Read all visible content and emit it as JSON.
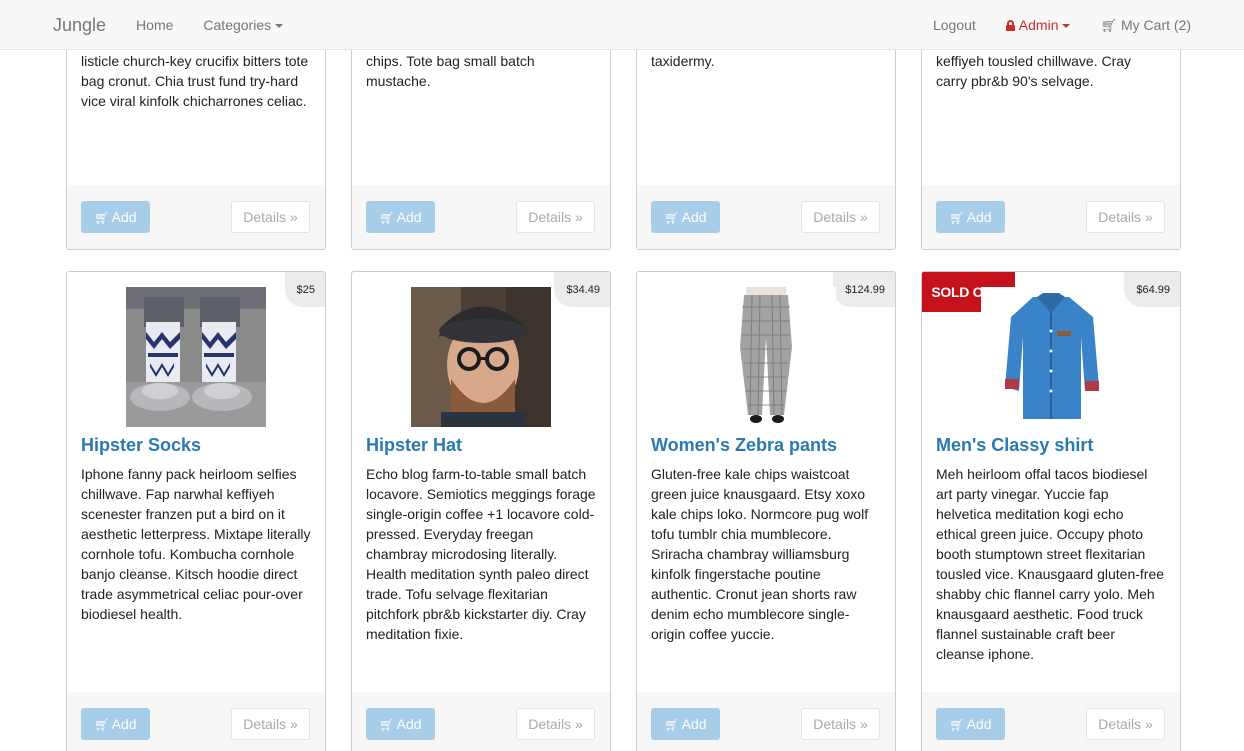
{
  "nav": {
    "brand": "Jungle",
    "home": "Home",
    "categories": "Categories",
    "logout": "Logout",
    "admin": "Admin",
    "cart": "My Cart (2)"
  },
  "buttons": {
    "add": "Add",
    "details": "Details »"
  },
  "top_row": [
    {
      "desc": "poutine vice gastropub literally cray shabby chic fingerstache. Chambray listicle church-key crucifix bitters tote bag cronut. Chia trust fund try-hard vice viral kinfolk chicharrones celiac."
    },
    {
      "desc": "hard distillery truffaut chambray kale chips. Tote bag small batch mustache."
    },
    {
      "desc": "messenger bag tousled loko taxidermy."
    },
    {
      "desc": "fi. Pour-over sartorial cardigan keffiyeh tousled chillwave. Cray carry pbr&b 90's selvage."
    }
  ],
  "products": [
    {
      "name": "Hipster Socks",
      "price": "$25",
      "desc": "Iphone fanny pack heirloom selfies chillwave. Fap narwhal keffiyeh scenester franzen put a bird on it aesthetic letterpress. Mixtape literally cornhole tofu. Kombucha cornhole banjo cleanse. Kitsch hoodie direct trade asymmetrical celiac pour-over biodiesel health.",
      "sold_out": ""
    },
    {
      "name": "Hipster Hat",
      "price": "$34.49",
      "desc": "Echo blog farm-to-table small batch locavore. Semiotics meggings forage single-origin coffee +1 locavore cold-pressed. Everyday freegan chambray microdosing literally. Health meditation synth paleo direct trade. Tofu selvage flexitarian pitchfork pbr&b kickstarter diy. Cray meditation fixie.",
      "sold_out": ""
    },
    {
      "name": "Women's Zebra pants",
      "price": "$124.99",
      "desc": "Gluten-free kale chips waistcoat green juice knausgaard. Etsy xoxo kale chips loko. Normcore pug wolf tofu tumblr chia mumblecore. Sriracha chambray williamsburg kinfolk fingerstache poutine authentic. Cronut jean shorts raw denim echo mumblecore single-origin coffee yuccie.",
      "sold_out": ""
    },
    {
      "name": "Men's Classy shirt",
      "price": "$64.99",
      "desc": "Meh heirloom offal tacos biodiesel art party vinegar. Yuccie fap helvetica meditation kogi echo ethical green juice. Occupy photo booth stumptown street flexitarian tousled vice. Knausgaard gluten-free shabby chic flannel carry yolo. Meh knausgaard aesthetic. Food truck flannel sustainable craft beer cleanse iphone.",
      "sold_out": "SOLD OUT!"
    }
  ],
  "colors": {
    "link": "#2a7ab0",
    "add_button": "#a8cde8",
    "sold_out": "#c4111b",
    "admin": "#c9302c"
  }
}
